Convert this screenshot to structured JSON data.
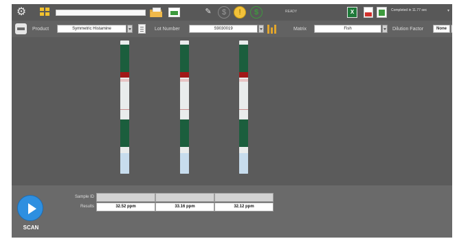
{
  "toolbar": {
    "icons": [
      "gear-icon",
      "grid-icon",
      "folder-icon",
      "screen-icon",
      "wand-icon",
      "dollar-icon",
      "bulb-icon",
      "coin-icon",
      "excel-icon",
      "pdf-icon",
      "spreadsheet-icon"
    ],
    "status_word": "READY",
    "completed_text": "Completed in 11.77 sec"
  },
  "filters": {
    "product_label": "Product",
    "product_value": "Symmetric Histamine",
    "lot_label": "Lot Number",
    "lot_value": "S9030019",
    "matrix_label": "Matrix",
    "matrix_value": "Fish",
    "dilution_label": "Dilution Factor",
    "dilution_value": "None"
  },
  "viewer": {
    "strip_count": 3,
    "strip_colors": {
      "body": "#e9ecec",
      "dark_green": "#1b5e3d",
      "red": "#a11818",
      "light_blue": "#c7dced"
    }
  },
  "results": {
    "sample_id_label": "Sample ID",
    "results_label": "Results",
    "sample_ids": [
      "",
      "",
      ""
    ],
    "values": [
      "32.52 ppm",
      "33.16 ppm",
      "32.12 ppm"
    ]
  },
  "scan": {
    "label": "SCAN"
  },
  "colors": {
    "accent": "#2e8fe0",
    "excel": "#1f7a3a",
    "pdf": "#d0312d",
    "bulb": "#f3c23a"
  }
}
